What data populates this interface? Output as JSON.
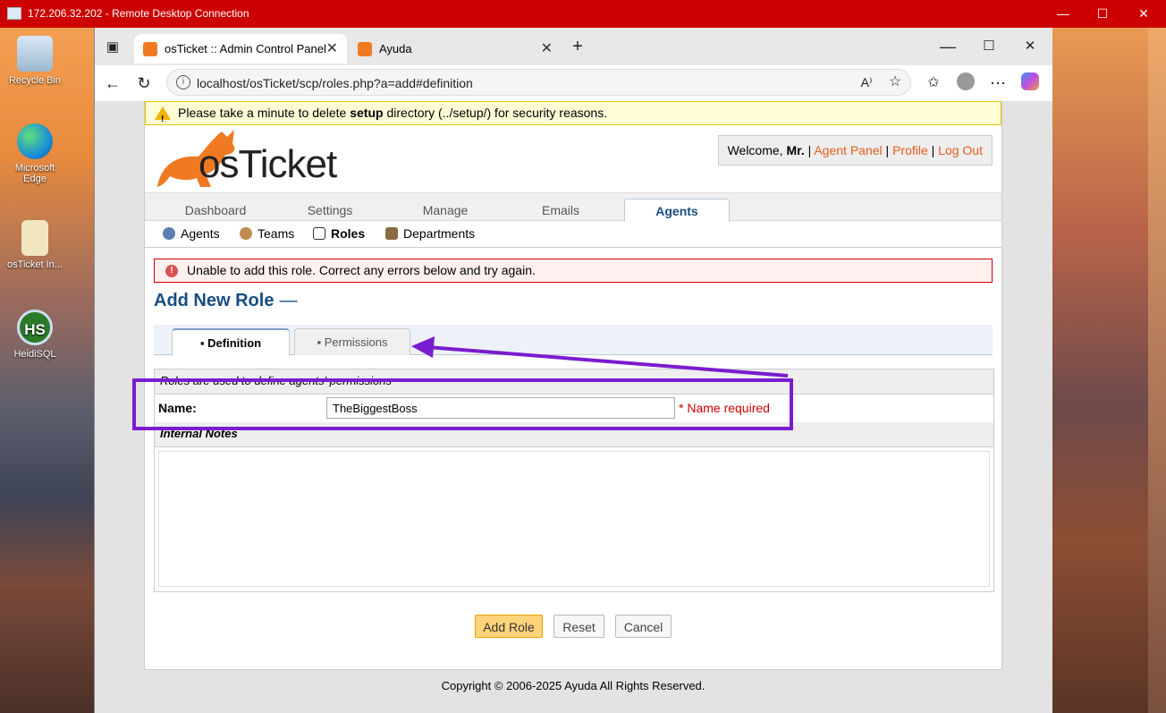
{
  "rdp": {
    "title": "172.206.32.202 - Remote Desktop Connection"
  },
  "desktop": {
    "icons": [
      "Recycle Bin",
      "Microsoft Edge",
      "osTicket In...",
      "HeidiSQL"
    ]
  },
  "browser": {
    "tabs": [
      {
        "label": "osTicket :: Admin Control Panel"
      },
      {
        "label": "Ayuda"
      }
    ],
    "url": "localhost/osTicket/scp/roles.php?a=add#definition"
  },
  "page": {
    "warning_pre": "Please take a minute to delete ",
    "warning_bold": "setup",
    "warning_post": " directory (../setup/) for security reasons.",
    "logo_text": "osTicket",
    "welcome": {
      "prefix": "Welcome, ",
      "user": "Mr.",
      "sep": " | ",
      "agent_panel": "Agent Panel",
      "profile": "Profile",
      "logout": "Log Out"
    },
    "nav_tabs": [
      "Dashboard",
      "Settings",
      "Manage",
      "Emails",
      "Agents"
    ],
    "sub_nav": [
      "Agents",
      "Teams",
      "Roles",
      "Departments"
    ],
    "error": "Unable to add this role. Correct any errors below and try again.",
    "title": "Add New Role",
    "title_dash": "—",
    "form_tabs": [
      "Definition",
      "Permissions"
    ],
    "form": {
      "header": "Roles are used to define agents' permissions",
      "name_label": "Name:",
      "name_value": "TheBiggestBoss",
      "name_error": "* Name required",
      "notes_header": "Internal Notes"
    },
    "buttons": {
      "add": "Add Role",
      "reset": "Reset",
      "cancel": "Cancel"
    },
    "copyright": "Copyright © 2006-2025 Ayuda All Rights Reserved."
  },
  "colors": {
    "accent": "#184e81",
    "link": "#e45c1c",
    "annotation": "#7a1ccf",
    "rdp_bar": "#cc0000"
  }
}
